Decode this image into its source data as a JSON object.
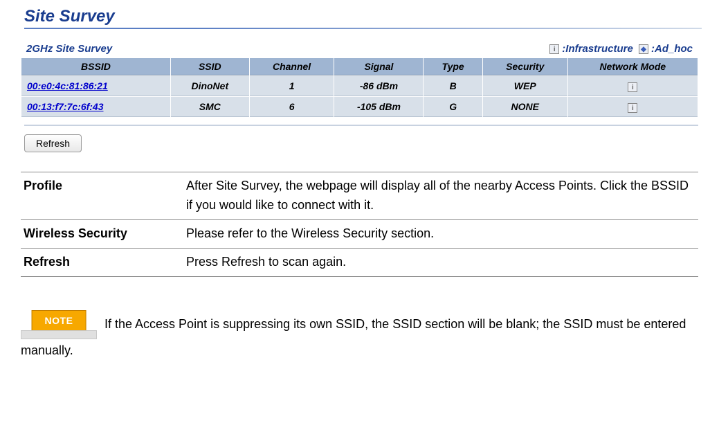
{
  "page_title": "Site Survey",
  "survey_label": "2GHz Site Survey",
  "legend": {
    "infra_label": ":Infrastructure",
    "adhoc_label": ":Ad_hoc"
  },
  "table": {
    "headers": {
      "bssid": "BSSID",
      "ssid": "SSID",
      "channel": "Channel",
      "signal": "Signal",
      "type": "Type",
      "security": "Security",
      "mode": "Network Mode"
    },
    "rows": [
      {
        "bssid": "00:e0:4c:81:86:21",
        "ssid": "DinoNet",
        "channel": "1",
        "signal": "-86 dBm",
        "type": "B",
        "security": "WEP",
        "mode_icon": "i"
      },
      {
        "bssid": "00:13:f7:7c:6f:43",
        "ssid": "SMC",
        "channel": "6",
        "signal": "-105 dBm",
        "type": "G",
        "security": "NONE",
        "mode_icon": "i"
      }
    ]
  },
  "refresh_label": "Refresh",
  "descriptions": [
    {
      "term": "Profile",
      "text": "After Site Survey, the webpage will display all of the nearby Access Points. Click the BSSID if you would like to connect with it."
    },
    {
      "term": "Wireless Security",
      "text": "Please refer to the Wireless Security section."
    },
    {
      "term": "Refresh",
      "text": "Press Refresh to scan again."
    }
  ],
  "note": {
    "badge": "NOTE",
    "text": " If the Access Point is suppressing its own SSID, the SSID section will be blank; the SSID must be entered manually."
  }
}
